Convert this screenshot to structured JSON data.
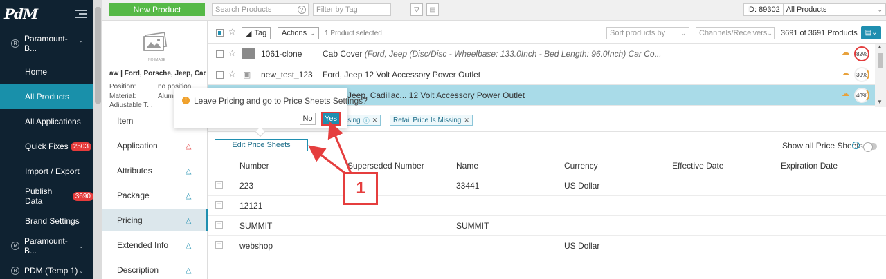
{
  "sidebar": {
    "logo": "PdM",
    "orgs": [
      {
        "label": "Paramount-B...",
        "badge": "R"
      },
      {
        "label": "Paramount-B...",
        "badge": "R"
      },
      {
        "label": "PDM (Temp 1)",
        "badge": "R"
      }
    ],
    "items": [
      {
        "label": "Home"
      },
      {
        "label": "All Products"
      },
      {
        "label": "All Applications"
      },
      {
        "label": "Quick Fixes",
        "badge": "2503"
      },
      {
        "label": "Import / Export"
      },
      {
        "label": "Publish Data",
        "badge": "3690"
      },
      {
        "label": "Brand Settings"
      }
    ]
  },
  "topbar": {
    "new_product": "New Product",
    "search_placeholder": "Search Products",
    "tag_placeholder": "Filter by Tag",
    "id_label": "ID: 89302",
    "scope": "All Products"
  },
  "preview": {
    "image_caption": "NO IMAGE",
    "title": "aw | Ford, Porsche, Jeep, Cadi...",
    "position_label": "Position:",
    "position_value": "no position",
    "material_label": "Material:",
    "material_value": "Alum...",
    "cut_label": "Adjustable T..."
  },
  "list": {
    "tag_btn": "Tag",
    "actions_btn": "Actions",
    "selected_text": "1 Product selected",
    "sort_placeholder": "Sort products by",
    "channels_placeholder": "Channels/Receivers",
    "total": "3691 of 3691 Products",
    "rows": [
      {
        "name": "1061-clone",
        "desc": "Cab Cover",
        "desc_italic": "(Ford, Jeep (Disc/Disc - Wheelbase: 133.0Inch - Bed Length: 96.0Inch) Car Co...",
        "pct": "82%"
      },
      {
        "name": "new_test_123",
        "desc": "Ford, Jeep 12 Volt Accessory Power Outlet",
        "desc_italic": "",
        "pct": "30%"
      },
      {
        "name": "",
        "desc": "rsche, Jeep, Cadillac... 12 Volt Accessory Power Outlet",
        "desc_italic": "",
        "pct": "40%"
      }
    ]
  },
  "tabs": [
    {
      "label": "Item",
      "warn": ""
    },
    {
      "label": "Application",
      "warn": "red"
    },
    {
      "label": "Attributes",
      "warn": "blue"
    },
    {
      "label": "Package",
      "warn": "blue"
    },
    {
      "label": "Pricing",
      "warn": "blue"
    },
    {
      "label": "Extended Info",
      "warn": "blue"
    },
    {
      "label": "Description",
      "warn": "blue"
    }
  ],
  "detail": {
    "chips": [
      "issing",
      "Retail Price Is Missing"
    ],
    "edit_btn": "Edit Price Sheets",
    "show_all": "Show all Price Sheets",
    "columns": [
      "Number",
      "Superseded Number",
      "Name",
      "Currency",
      "Effective Date",
      "Expiration Date"
    ],
    "rows": [
      [
        "223",
        "",
        "33441",
        "US Dollar",
        "",
        ""
      ],
      [
        "12121",
        "",
        "",
        "",
        "",
        ""
      ],
      [
        "SUMMIT",
        "",
        "SUMMIT",
        "",
        "",
        ""
      ],
      [
        "webshop",
        "",
        "",
        "US Dollar",
        "",
        ""
      ]
    ]
  },
  "popup": {
    "message": "Leave Pricing and go to Price Sheets Settings?",
    "no": "No",
    "yes": "Yes"
  },
  "annotation": {
    "label": "1",
    "color": "#e53e3e"
  }
}
